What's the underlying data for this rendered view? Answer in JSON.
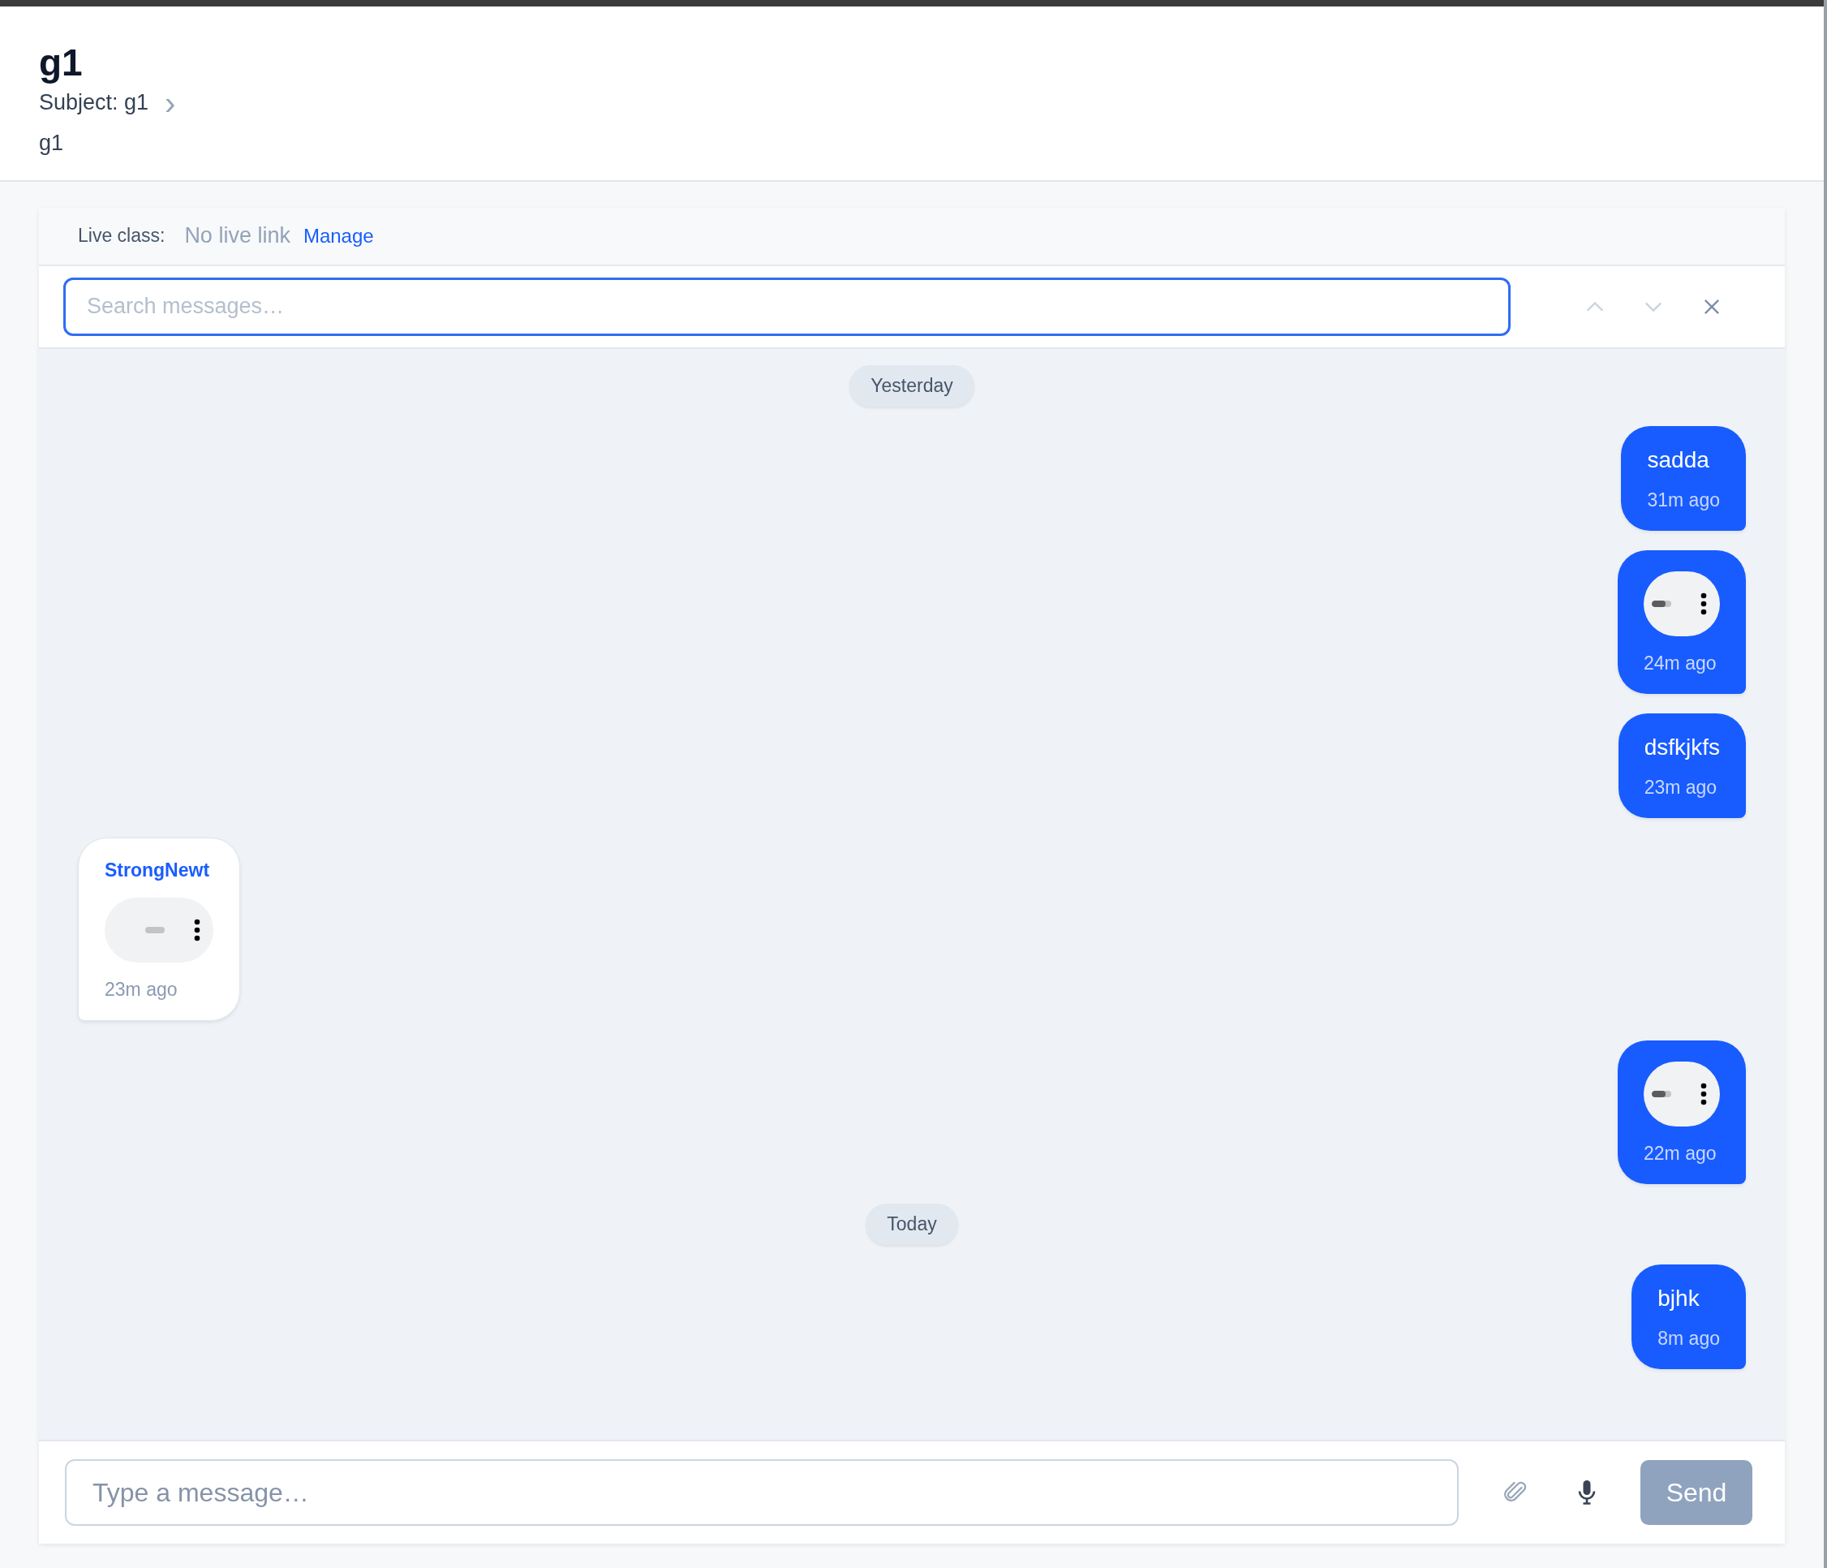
{
  "header": {
    "title": "g1",
    "subject": "Subject: g1",
    "chevron": "›",
    "description": "g1"
  },
  "live_class": {
    "label": "Live class:",
    "value": "No live link",
    "link": "Manage"
  },
  "search": {
    "placeholder": "Search messages…"
  },
  "messages": [
    {
      "kind": "date",
      "label": "Yesterday"
    },
    {
      "kind": "text",
      "outgoing": true,
      "text": "sadda",
      "time": "31m ago"
    },
    {
      "kind": "audio",
      "outgoing": true,
      "level": 0.7,
      "time": "24m ago"
    },
    {
      "kind": "text",
      "outgoing": true,
      "text": "dsfkjkfs",
      "time": "23m ago"
    },
    {
      "kind": "audio",
      "outgoing": false,
      "sender": "StrongNewt",
      "level": 0,
      "time": "23m ago"
    },
    {
      "kind": "audio",
      "outgoing": true,
      "level": 0.7,
      "time": "22m ago"
    },
    {
      "kind": "date",
      "label": "Today"
    },
    {
      "kind": "text",
      "outgoing": true,
      "text": "bjhk",
      "time": "8m ago"
    }
  ],
  "composer": {
    "placeholder": "Type a message…",
    "send": {
      "label": "Send",
      "disabled": true
    }
  }
}
